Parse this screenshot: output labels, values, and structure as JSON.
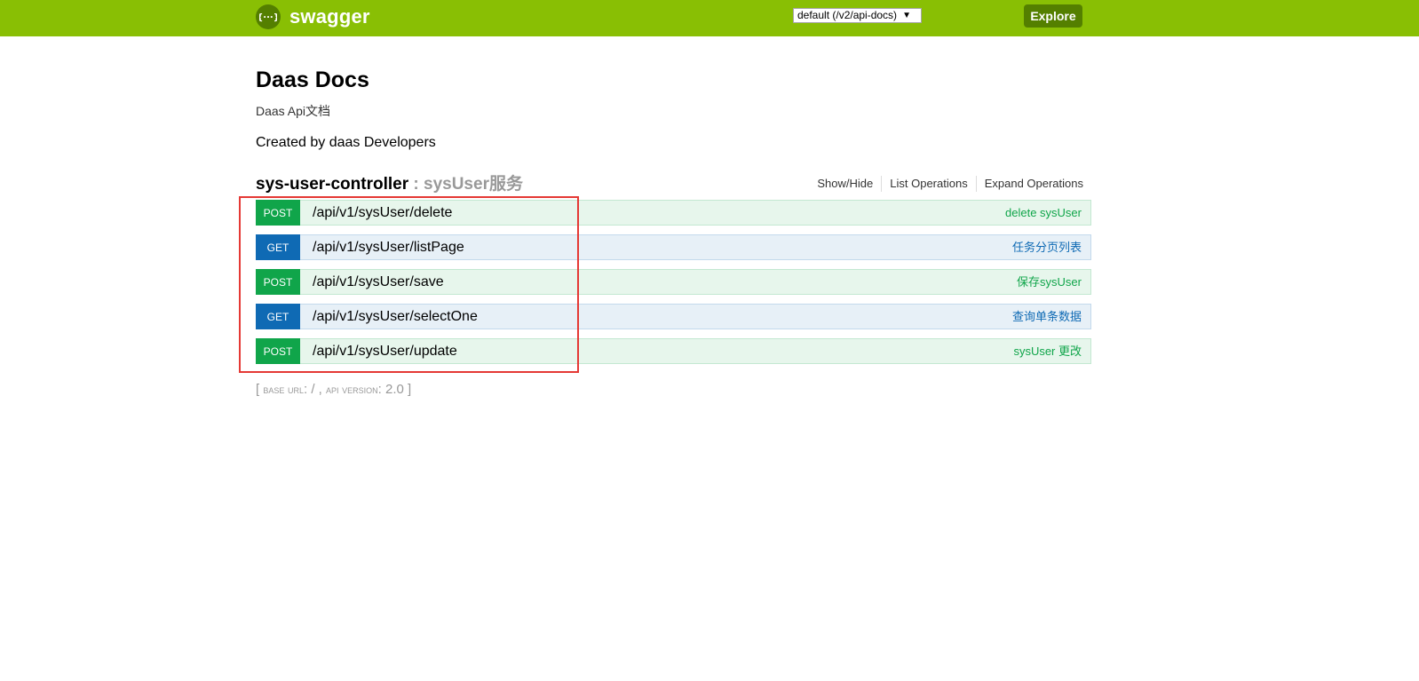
{
  "header": {
    "logo_text": "swagger",
    "logo_icon_glyph": "{···}",
    "spec_select": "default (/v2/api-docs)",
    "explore_label": "Explore",
    "accent_color": "#89bf04"
  },
  "info": {
    "title": "Daas Docs",
    "description": "Daas Api文档",
    "contact": "Created by daas Developers"
  },
  "resource": {
    "name": "sys-user-controller",
    "description": " : sysUser服务",
    "options": {
      "show_hide": "Show/Hide",
      "list_operations": "List Operations",
      "expand_operations": "Expand Operations"
    },
    "operations": [
      {
        "method": "POST",
        "path": "/api/v1/sysUser/delete",
        "summary": "delete sysUser"
      },
      {
        "method": "GET",
        "path": "/api/v1/sysUser/listPage",
        "summary": "任务分页列表"
      },
      {
        "method": "POST",
        "path": "/api/v1/sysUser/save",
        "summary": "保存sysUser"
      },
      {
        "method": "GET",
        "path": "/api/v1/sysUser/selectOne",
        "summary": "查询单条数据"
      },
      {
        "method": "POST",
        "path": "/api/v1/sysUser/update",
        "summary": "sysUser 更改"
      }
    ]
  },
  "footer": {
    "open_bracket": "[ ",
    "base_url_label": "base url",
    "base_url_value": ": / , ",
    "api_version_label": "api version",
    "api_version_value": ": 2.0 ]"
  }
}
